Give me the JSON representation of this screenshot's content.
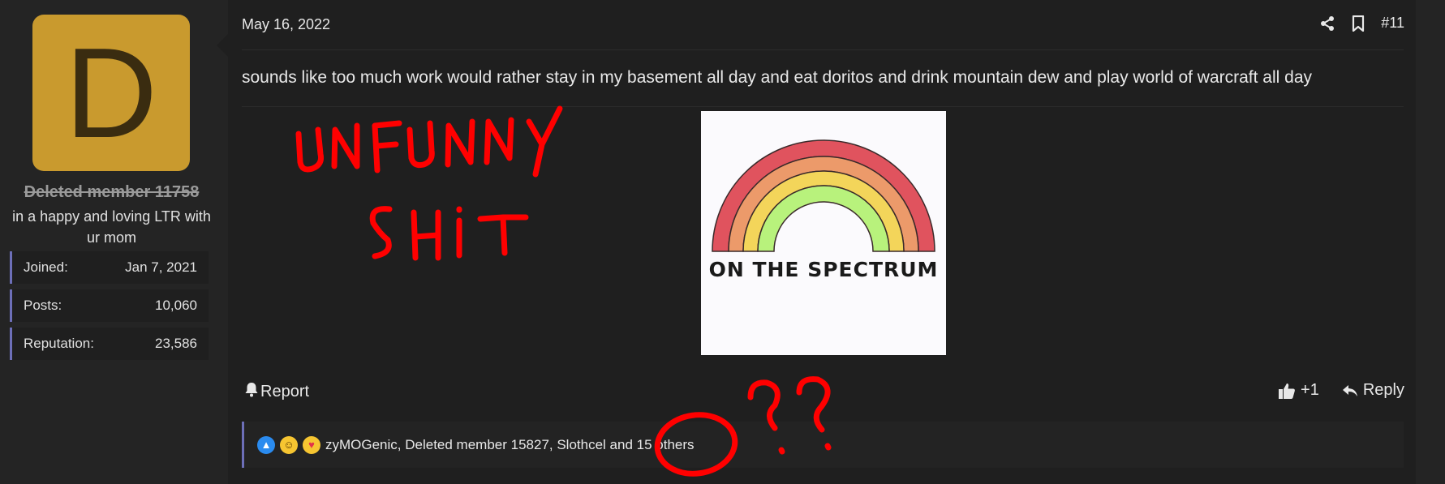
{
  "user": {
    "avatar_letter": "D",
    "avatar_color": "#c99a2e",
    "name": "Deleted member 11758",
    "title": "in a happy and loving LTR with ur mom",
    "stats": [
      {
        "label": "Joined:",
        "value": "Jan 7, 2021"
      },
      {
        "label": "Posts:",
        "value": "10,060"
      },
      {
        "label": "Reputation:",
        "value": "23,586"
      }
    ]
  },
  "post": {
    "date": "May 16, 2022",
    "number": "#11",
    "text": "sounds like too much work would rather stay in my basement all day and eat doritos and drink mountain dew and play world of warcraft all day",
    "image_caption": "ON THE SPECTRUM",
    "icons": [
      "share-icon",
      "bookmark-icon"
    ]
  },
  "actions": {
    "report_label": "Report",
    "like_count": "+1",
    "reply_label": "Reply"
  },
  "reactions": {
    "emojis": [
      "like-emoji",
      "haha-emoji",
      "love-emoji"
    ],
    "summary": "zyMOGenic, Deleted member 15827, Slothcel and 15 others"
  },
  "annotations": {
    "scrawl_line1": "UNFUNNY",
    "scrawl_line2": "SHIT",
    "scrawl_marks": "??",
    "scrawl_color": "#ff0000"
  },
  "colors": {
    "accent": "#6d6fb8",
    "background": "#1f1f1f"
  }
}
